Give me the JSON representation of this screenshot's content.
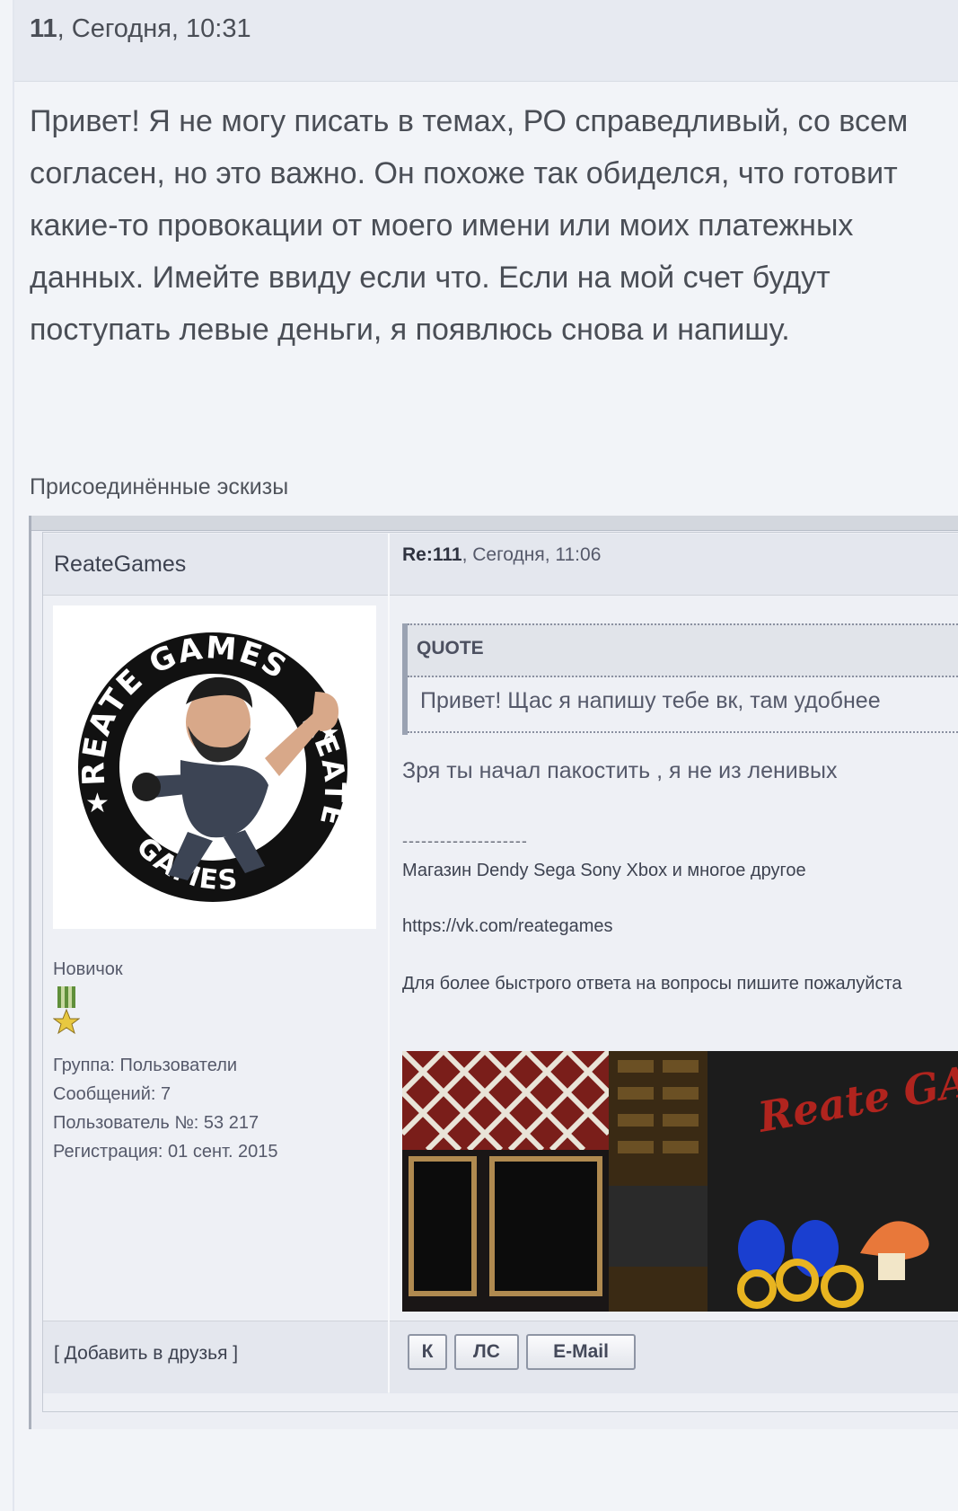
{
  "post": {
    "number": "11",
    "timestamp": ", Сегодня, 10:31",
    "body": "Привет! Я не могу писать в темах, РО справедливый, со всем согласен, но это важно. Он похоже так обиделся, что готовит какие-то провокации от моего имени или моих платежных данных. Имейте ввиду если что. Если на мой счет будут поступать левые деньги, я появлюсь снова и напишу.",
    "attachments_label": "Присоединённые эскизы"
  },
  "screenshot": {
    "username": "ReateGames",
    "reply_title": "Re:111",
    "reply_time": ", Сегодня, 11:06",
    "avatar_text_top": "REATE GAMES",
    "avatar_text_right": "REATE",
    "avatar_text_bottom": "GAMES",
    "rank": "Новичок",
    "stats": {
      "group": "Группа: Пользователи",
      "messages": "Сообщений: 7",
      "user_no": "Пользователь №: 53 217",
      "registration": "Регистрация: 01 сент. 2015"
    },
    "quote_label": "QUOTE",
    "quote_text": "Привет! Щас я напишу тебе вк, там удобнее",
    "reply_text": "Зря ты начал пакостить , я не из ленивых",
    "signature": {
      "rule": "--------------------",
      "line1": "Магазин Dendy Sega Sony Xbox и многое другое",
      "line2": "https://vk.com/reategames",
      "line3": "Для более быстрого ответа на вопросы пишите пожалуйста"
    },
    "banner_text": "Reate GAMES",
    "add_friend": "[ Добавить в друзья ]",
    "buttons": {
      "k": "К",
      "pm": "ЛС",
      "email": "E-Mail"
    }
  },
  "colors": {
    "page_bg": "#f2f4f8",
    "header_bg": "#e7eaf1",
    "text": "#4a4e56",
    "banner_red": "#b0241e"
  }
}
